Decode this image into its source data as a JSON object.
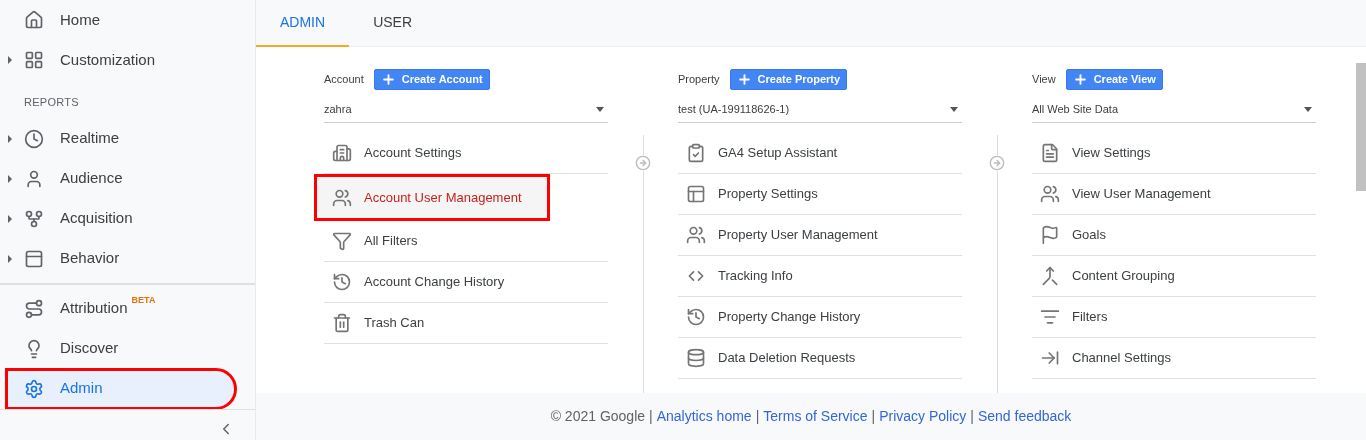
{
  "sidebar": {
    "sections": [
      {
        "items": [
          {
            "label": "Home",
            "collapsible": false,
            "selected": false
          },
          {
            "label": "Customization",
            "collapsible": true,
            "selected": false
          }
        ]
      },
      {
        "heading": "REPORTS",
        "items": [
          {
            "label": "Realtime",
            "collapsible": true,
            "selected": false
          },
          {
            "label": "Audience",
            "collapsible": true,
            "selected": false
          },
          {
            "label": "Acquisition",
            "collapsible": true,
            "selected": false
          },
          {
            "label": "Behavior",
            "collapsible": true,
            "selected": false
          }
        ]
      },
      {
        "items": [
          {
            "label": "Attribution",
            "badge": "BETA",
            "collapsible": false,
            "selected": false
          },
          {
            "label": "Discover",
            "collapsible": false,
            "selected": false
          },
          {
            "label": "Admin",
            "collapsible": false,
            "selected": true
          }
        ]
      }
    ]
  },
  "tabs": [
    {
      "label": "ADMIN",
      "selected": true
    },
    {
      "label": "USER",
      "selected": false
    }
  ],
  "columns": [
    {
      "label": "Account",
      "create_button": "Create Account",
      "dropdown": "zahra",
      "items": [
        {
          "label": "Account Settings",
          "selected": false
        },
        {
          "label": "Account User Management",
          "selected": true
        },
        {
          "label": "All Filters",
          "selected": false
        },
        {
          "label": "Account Change History",
          "selected": false
        },
        {
          "label": "Trash Can",
          "selected": false
        }
      ]
    },
    {
      "label": "Property",
      "create_button": "Create Property",
      "dropdown": "test (UA-199118626-1)",
      "items": [
        {
          "label": "GA4 Setup Assistant",
          "selected": false
        },
        {
          "label": "Property Settings",
          "selected": false
        },
        {
          "label": "Property User Management",
          "selected": false
        },
        {
          "label": "Tracking Info",
          "selected": false
        },
        {
          "label": "Property Change History",
          "selected": false
        },
        {
          "label": "Data Deletion Requests",
          "selected": false
        }
      ]
    },
    {
      "label": "View",
      "create_button": "Create View",
      "dropdown": "All Web Site Data",
      "items": [
        {
          "label": "View Settings",
          "selected": false
        },
        {
          "label": "View User Management",
          "selected": false
        },
        {
          "label": "Goals",
          "selected": false
        },
        {
          "label": "Content Grouping",
          "selected": false
        },
        {
          "label": "Filters",
          "selected": false
        },
        {
          "label": "Channel Settings",
          "selected": false
        }
      ]
    }
  ],
  "footer": {
    "copyright": "© 2021 Google",
    "separator": "|",
    "links": [
      "Analytics home",
      "Terms of Service",
      "Privacy Policy",
      "Send feedback"
    ]
  }
}
